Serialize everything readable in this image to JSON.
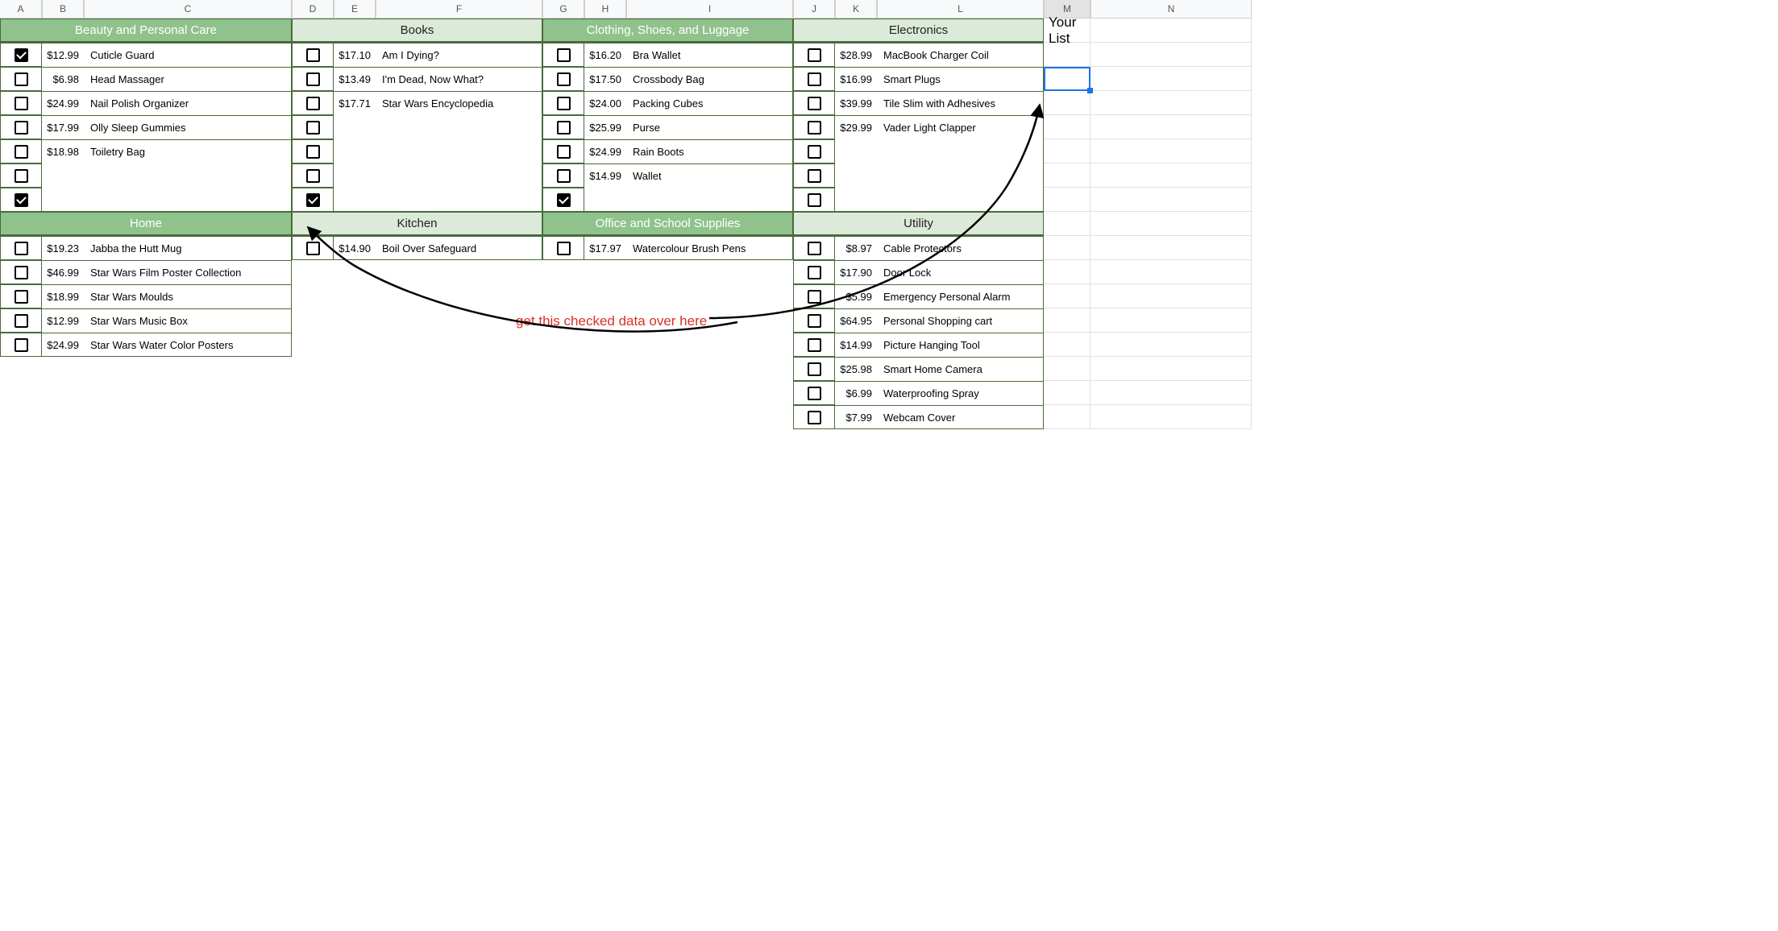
{
  "columns": [
    "A",
    "B",
    "C",
    "D",
    "E",
    "F",
    "G",
    "H",
    "I",
    "J",
    "K",
    "L",
    "M",
    "N"
  ],
  "selected_column": "M",
  "your_list_label": "Your List",
  "annotation_text": "get this checked data over here",
  "active_cell": {
    "col": "M",
    "row": 4
  },
  "sections": [
    {
      "id": "beauty",
      "title": "Beauty and Personal Care",
      "selected": true,
      "col_start": 0,
      "row_start": 0,
      "rows": 7,
      "items": [
        {
          "price": "$12.99",
          "name": "Cuticle Guard",
          "checked": true
        },
        {
          "price": "$6.98",
          "name": "Head Massager",
          "checked": false
        },
        {
          "price": "$24.99",
          "name": "Nail Polish Organizer",
          "checked": false
        },
        {
          "price": "$17.99",
          "name": "Olly Sleep Gummies",
          "checked": false
        },
        {
          "price": "$18.98",
          "name": "Toiletry Bag",
          "checked": false
        },
        {
          "price": "",
          "name": "",
          "checked": false,
          "blank": true
        },
        {
          "price": "",
          "name": "",
          "checked": true,
          "blank": true
        }
      ]
    },
    {
      "id": "books",
      "title": "Books",
      "selected": false,
      "col_start": 3,
      "row_start": 0,
      "rows": 7,
      "items": [
        {
          "price": "$17.10",
          "name": "Am I Dying?",
          "checked": false
        },
        {
          "price": "$13.49",
          "name": "I'm Dead, Now What?",
          "checked": false
        },
        {
          "price": "$17.71",
          "name": "Star Wars Encyclopedia",
          "checked": false
        },
        {
          "price": "",
          "name": "",
          "checked": false,
          "blank": true
        },
        {
          "price": "",
          "name": "",
          "checked": false,
          "blank": true
        },
        {
          "price": "",
          "name": "",
          "checked": false,
          "blank": true
        },
        {
          "price": "",
          "name": "",
          "checked": true,
          "blank": true
        }
      ]
    },
    {
      "id": "clothing",
      "title": "Clothing, Shoes, and Luggage",
      "selected": true,
      "col_start": 6,
      "row_start": 0,
      "rows": 7,
      "items": [
        {
          "price": "$16.20",
          "name": "Bra Wallet",
          "checked": false
        },
        {
          "price": "$17.50",
          "name": "Crossbody Bag",
          "checked": false
        },
        {
          "price": "$24.00",
          "name": "Packing Cubes",
          "checked": false
        },
        {
          "price": "$25.99",
          "name": "Purse",
          "checked": false
        },
        {
          "price": "$24.99",
          "name": "Rain Boots",
          "checked": false
        },
        {
          "price": "$14.99",
          "name": "Wallet",
          "checked": false
        },
        {
          "price": "",
          "name": "",
          "checked": true,
          "blank": true
        }
      ]
    },
    {
      "id": "electronics",
      "title": "Electronics",
      "selected": false,
      "col_start": 9,
      "row_start": 0,
      "rows": 7,
      "items": [
        {
          "price": "$28.99",
          "name": "MacBook Charger Coil",
          "checked": false
        },
        {
          "price": "$16.99",
          "name": "Smart Plugs",
          "checked": false
        },
        {
          "price": "$39.99",
          "name": "Tile Slim with Adhesives",
          "checked": false
        },
        {
          "price": "$29.99",
          "name": "Vader Light Clapper",
          "checked": false
        },
        {
          "price": "",
          "name": "",
          "checked": false,
          "blank": true
        },
        {
          "price": "",
          "name": "",
          "checked": false,
          "blank": true
        },
        {
          "price": "",
          "name": "",
          "checked": false,
          "blank": true
        }
      ]
    },
    {
      "id": "home",
      "title": "Home",
      "selected": true,
      "col_start": 0,
      "row_start": 1,
      "rows": 5,
      "items": [
        {
          "price": "$19.23",
          "name": "Jabba the Hutt Mug",
          "checked": false
        },
        {
          "price": "$46.99",
          "name": "Star Wars Film Poster Collection",
          "checked": false
        },
        {
          "price": "$18.99",
          "name": "Star Wars Moulds",
          "checked": false
        },
        {
          "price": "$12.99",
          "name": "Star Wars Music Box",
          "checked": false
        },
        {
          "price": "$24.99",
          "name": "Star Wars Water Color Posters",
          "checked": false
        }
      ]
    },
    {
      "id": "kitchen",
      "title": "Kitchen",
      "selected": false,
      "col_start": 3,
      "row_start": 1,
      "rows": 1,
      "items": [
        {
          "price": "$14.90",
          "name": "Boil Over Safeguard",
          "checked": false
        }
      ]
    },
    {
      "id": "office",
      "title": "Office and School Supplies",
      "selected": true,
      "col_start": 6,
      "row_start": 1,
      "rows": 1,
      "items": [
        {
          "price": "$17.97",
          "name": "Watercolour Brush Pens",
          "checked": false
        }
      ]
    },
    {
      "id": "utility",
      "title": "Utility",
      "selected": false,
      "col_start": 9,
      "row_start": 1,
      "rows": 8,
      "items": [
        {
          "price": "$8.97",
          "name": "Cable Protectors",
          "checked": false
        },
        {
          "price": "$17.90",
          "name": "Door Lock",
          "checked": false
        },
        {
          "price": "$5.99",
          "name": "Emergency Personal Alarm",
          "checked": false
        },
        {
          "price": "$64.95",
          "name": "Personal Shopping cart",
          "checked": false
        },
        {
          "price": "$14.99",
          "name": "Picture Hanging Tool",
          "checked": false
        },
        {
          "price": "$25.98",
          "name": "Smart Home Camera",
          "checked": false
        },
        {
          "price": "$6.99",
          "name": "Waterproofing Spray",
          "checked": false
        },
        {
          "price": "$7.99",
          "name": "Webcam Cover",
          "checked": false
        }
      ]
    }
  ]
}
